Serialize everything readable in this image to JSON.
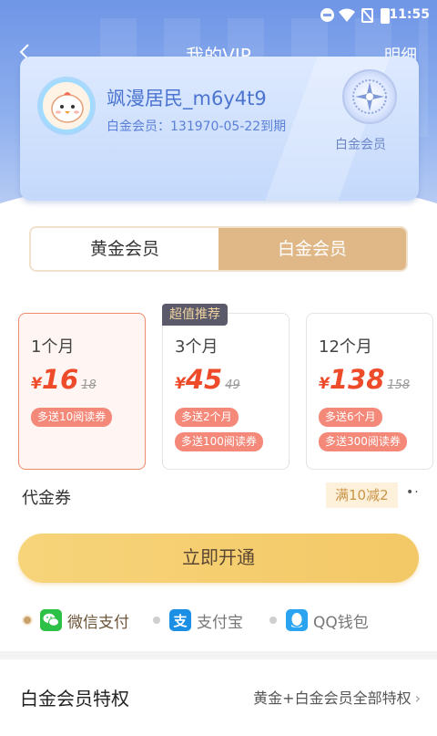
{
  "status_bar": {
    "time": "11:55"
  },
  "header": {
    "back_icon": "chevron-left-icon",
    "title": "我的VIP",
    "detail_label": "明细"
  },
  "vip_card": {
    "username": "飒漫居民_m6y4t9",
    "expiry_text": "白金会员：131970-05-22到期",
    "medal_label": "白金会员"
  },
  "tabs": [
    {
      "label": "黄金会员",
      "selected": false
    },
    {
      "label": "白金会员",
      "selected": true
    }
  ],
  "packages": {
    "recommend_badge": "超值推荐",
    "currency": "¥",
    "items": [
      {
        "duration": "1个月",
        "price": "16",
        "original_price": "18",
        "perks": [
          "多送10阅读券"
        ],
        "selected": true
      },
      {
        "duration": "3个月",
        "price": "45",
        "original_price": "49",
        "perks": [
          "多送2个月",
          "多送100阅读券"
        ],
        "selected": false
      },
      {
        "duration": "12个月",
        "price": "138",
        "original_price": "158",
        "perks": [
          "多送6个月",
          "多送300阅读券"
        ],
        "selected": false
      }
    ]
  },
  "voucher": {
    "label": "代金券",
    "value": "满10减2",
    "more": "•·"
  },
  "cta": {
    "label": "立即开通"
  },
  "payment_methods": [
    {
      "label": "微信支付",
      "icon": "wechat-icon",
      "selected": true
    },
    {
      "label": "支付宝",
      "icon": "alipay-icon",
      "icon_text": "支",
      "selected": false
    },
    {
      "label": "QQ钱包",
      "icon": "qq-wallet-icon",
      "selected": false
    }
  ],
  "privileges": {
    "title": "白金会员特权",
    "link_label": "黄金+白金会员全部特权",
    "chevron": "›"
  },
  "colors": {
    "accent_gold": "#e0b888",
    "price_red": "#ee4b2b",
    "header_blue": "#7fa0ea",
    "cta_yellow": "#f5cf70"
  }
}
